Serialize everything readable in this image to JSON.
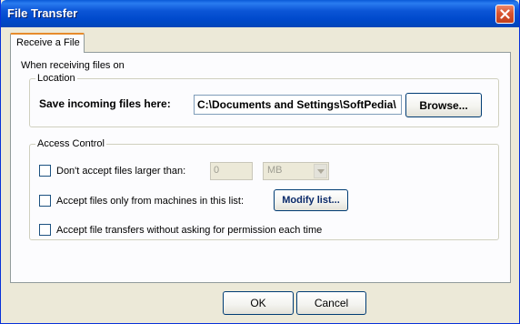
{
  "window": {
    "title": "File Transfer"
  },
  "tabs": [
    {
      "label": "Receive a File"
    }
  ],
  "panel": {
    "label": "When receiving files on"
  },
  "location": {
    "legend": "Location",
    "save_label": "Save incoming files here:",
    "path_value": "C:\\Documents and Settings\\SoftPedia\\",
    "browse_label": "Browse..."
  },
  "access": {
    "legend": "Access Control",
    "max_size_label": "Don't accept files larger than:",
    "max_size_value": "0",
    "unit_value": "MB",
    "machines_label": "Accept files only from machines in this list:",
    "modify_label": "Modify list...",
    "no_ask_label": "Accept file transfers without asking for permission each time"
  },
  "footer": {
    "ok_label": "OK",
    "cancel_label": "Cancel"
  }
}
